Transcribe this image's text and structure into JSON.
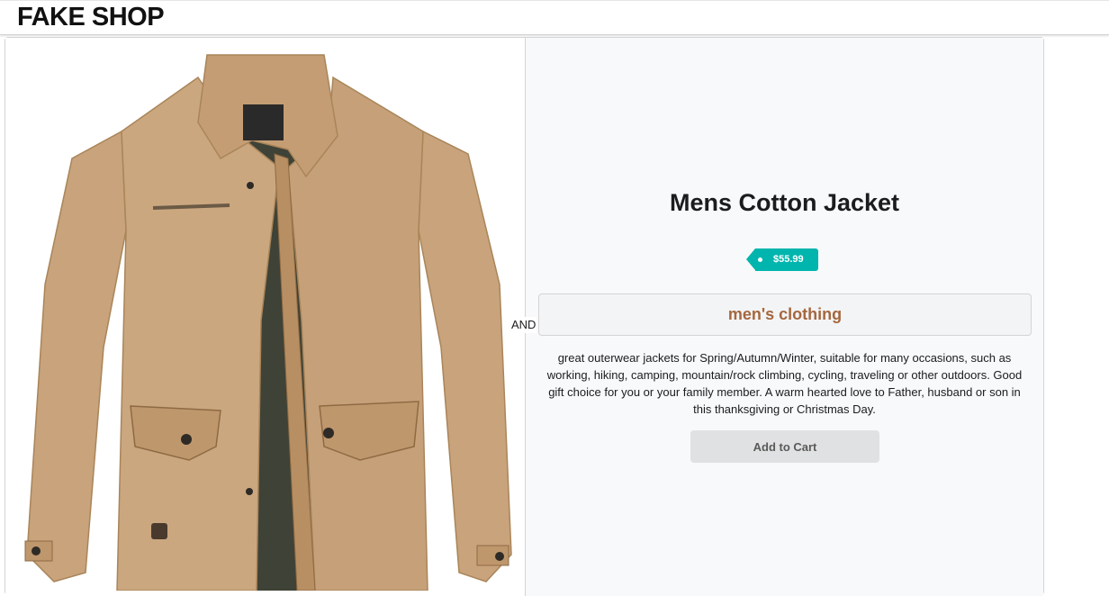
{
  "header": {
    "brand": "FAKE SHOP"
  },
  "product": {
    "image_alt": "Mens Cotton Jacket",
    "image_icon": "jacket-image",
    "connector": "AND",
    "title": "Mens Cotton Jacket",
    "price": "$55.99",
    "category": "men's clothing",
    "description": "great outerwear jackets for Spring/Autumn/Winter, suitable for many occasions, such as working, hiking, camping, mountain/rock climbing, cycling, traveling or other outdoors. Good gift choice for you or your family member. A warm hearted love to Father, husband or son in this thanksgiving or Christmas Day.",
    "add_to_cart_label": "Add to Cart"
  },
  "colors": {
    "price_tag": "#00b5ad",
    "category_text": "#a5673f",
    "jacket_fabric": "#c8a37c",
    "jacket_lining": "#3f4236"
  }
}
